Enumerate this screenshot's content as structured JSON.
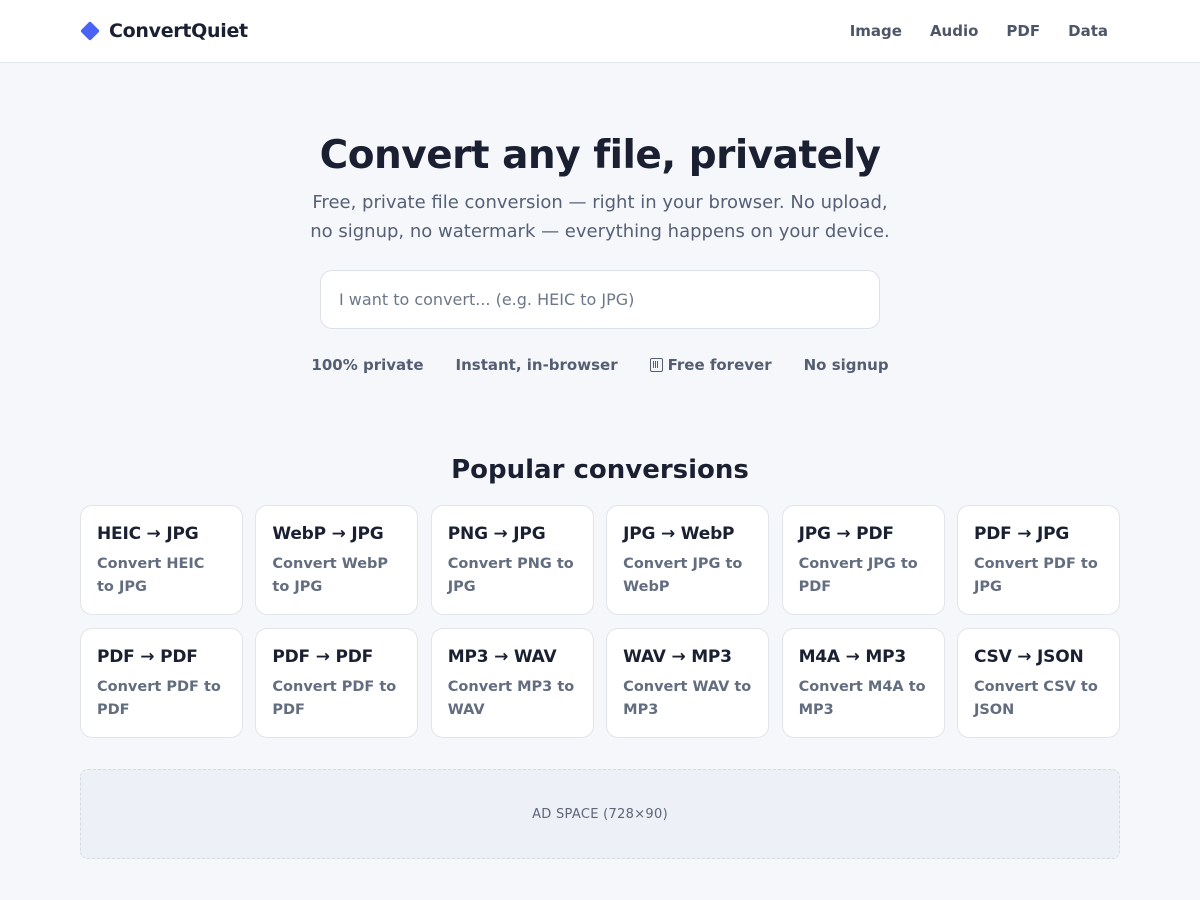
{
  "brand": {
    "name": "ConvertQuiet",
    "icon": "diamond-icon",
    "color": "#4a63f5"
  },
  "nav": [
    {
      "label": "Image"
    },
    {
      "label": "Audio"
    },
    {
      "label": "PDF"
    },
    {
      "label": "Data"
    }
  ],
  "hero": {
    "title": "Convert any file, privately",
    "subtitle": "Free, private file conversion — right in your browser. No upload, no signup, no watermark — everything happens on your device.",
    "search_placeholder": "I want to convert... (e.g. HEIC to JPG)",
    "search_value": ""
  },
  "features": [
    {
      "label": "100% private"
    },
    {
      "label": "Instant, in-browser"
    },
    {
      "label": "Free forever",
      "icon": "gift-icon"
    },
    {
      "label": "No signup"
    }
  ],
  "popular": {
    "title": "Popular conversions",
    "cards": [
      {
        "title": "HEIC → JPG",
        "desc": "Convert HEIC to JPG"
      },
      {
        "title": "WebP → JPG",
        "desc": "Convert WebP to JPG"
      },
      {
        "title": "PNG → JPG",
        "desc": "Convert PNG to JPG"
      },
      {
        "title": "JPG → WebP",
        "desc": "Convert JPG to WebP"
      },
      {
        "title": "JPG → PDF",
        "desc": "Convert JPG to PDF"
      },
      {
        "title": "PDF → JPG",
        "desc": "Convert PDF to JPG"
      },
      {
        "title": "PDF → PDF",
        "desc": "Convert PDF to PDF"
      },
      {
        "title": "PDF → PDF",
        "desc": "Convert PDF to PDF"
      },
      {
        "title": "MP3 → WAV",
        "desc": "Convert MP3 to WAV"
      },
      {
        "title": "WAV → MP3",
        "desc": "Convert WAV to MP3"
      },
      {
        "title": "M4A → MP3",
        "desc": "Convert M4A to MP3"
      },
      {
        "title": "CSV → JSON",
        "desc": "Convert CSV to JSON"
      }
    ]
  },
  "ad": {
    "label": "AD SPACE (728×90)"
  }
}
